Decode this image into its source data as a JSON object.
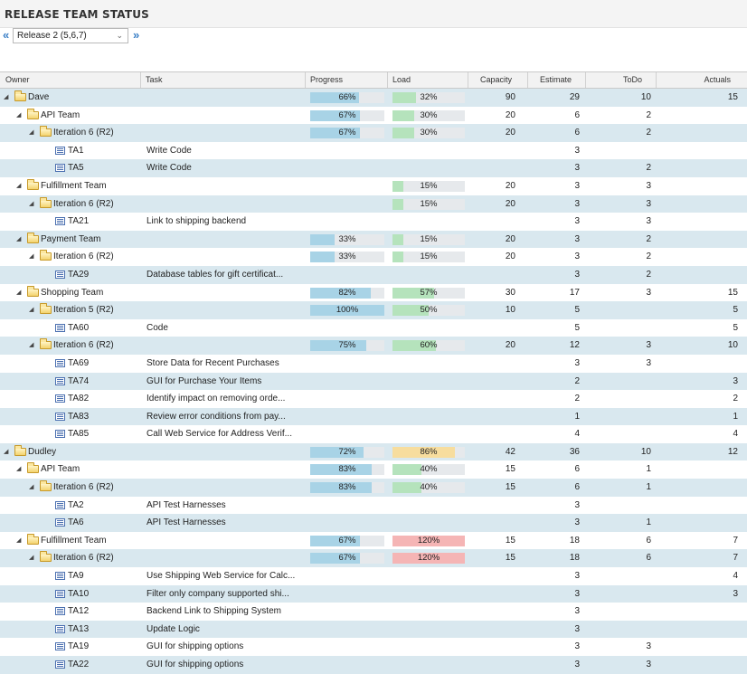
{
  "title": "RELEASE TEAM STATUS",
  "release_selector": {
    "prev": "«",
    "value": "Release 2 (5,6,7)",
    "next": "»"
  },
  "columns": {
    "owner": "Owner",
    "task": "Task",
    "progress": "Progress",
    "load": "Load",
    "capacity": "Capacity",
    "estimate": "Estimate",
    "todo": "ToDo",
    "actuals": "Actuals"
  },
  "colors": {
    "progress": "#a8d3e6",
    "load_normal": "#b5e3bc",
    "load_warning": "#f7dd9e",
    "load_over": "#f5b5b5"
  },
  "rows": [
    {
      "type": "owner",
      "level": 0,
      "owner": "Dave",
      "task": "",
      "progress": "66%",
      "progress_value": 66,
      "load": "32%",
      "load_value": 32,
      "load_state": "normal",
      "capacity": "90",
      "estimate": "29",
      "todo": "10",
      "actuals": "15"
    },
    {
      "type": "folder",
      "level": 1,
      "owner": "API Team",
      "task": "",
      "progress": "67%",
      "progress_value": 67,
      "load": "30%",
      "load_value": 30,
      "load_state": "normal",
      "capacity": "20",
      "estimate": "6",
      "todo": "2",
      "actuals": ""
    },
    {
      "type": "folder",
      "level": 2,
      "owner": "Iteration 6 (R2)",
      "task": "",
      "progress": "67%",
      "progress_value": 67,
      "load": "30%",
      "load_value": 30,
      "load_state": "normal",
      "capacity": "20",
      "estimate": "6",
      "todo": "2",
      "actuals": ""
    },
    {
      "type": "task",
      "level": 3,
      "owner": "TA1",
      "task": "Write Code",
      "progress": "",
      "load": "",
      "capacity": "",
      "estimate": "3",
      "todo": "",
      "actuals": ""
    },
    {
      "type": "task",
      "level": 3,
      "owner": "TA5",
      "task": "Write Code",
      "progress": "",
      "load": "",
      "capacity": "",
      "estimate": "3",
      "todo": "2",
      "actuals": ""
    },
    {
      "type": "folder",
      "level": 1,
      "owner": "Fulfillment Team",
      "task": "",
      "progress": "",
      "load": "15%",
      "load_value": 15,
      "load_state": "normal",
      "capacity": "20",
      "estimate": "3",
      "todo": "3",
      "actuals": ""
    },
    {
      "type": "folder",
      "level": 2,
      "owner": "Iteration 6 (R2)",
      "task": "",
      "progress": "",
      "load": "15%",
      "load_value": 15,
      "load_state": "normal",
      "capacity": "20",
      "estimate": "3",
      "todo": "3",
      "actuals": ""
    },
    {
      "type": "task",
      "level": 3,
      "owner": "TA21",
      "task": "Link to shipping backend",
      "progress": "",
      "load": "",
      "capacity": "",
      "estimate": "3",
      "todo": "3",
      "actuals": ""
    },
    {
      "type": "folder",
      "level": 1,
      "owner": "Payment Team",
      "task": "",
      "progress": "33%",
      "progress_value": 33,
      "load": "15%",
      "load_value": 15,
      "load_state": "normal",
      "capacity": "20",
      "estimate": "3",
      "todo": "2",
      "actuals": ""
    },
    {
      "type": "folder",
      "level": 2,
      "owner": "Iteration 6 (R2)",
      "task": "",
      "progress": "33%",
      "progress_value": 33,
      "load": "15%",
      "load_value": 15,
      "load_state": "normal",
      "capacity": "20",
      "estimate": "3",
      "todo": "2",
      "actuals": ""
    },
    {
      "type": "task",
      "level": 3,
      "owner": "TA29",
      "task": "Database tables for gift certificat...",
      "progress": "",
      "load": "",
      "capacity": "",
      "estimate": "3",
      "todo": "2",
      "actuals": ""
    },
    {
      "type": "folder",
      "level": 1,
      "owner": "Shopping Team",
      "task": "",
      "progress": "82%",
      "progress_value": 82,
      "load": "57%",
      "load_value": 57,
      "load_state": "normal",
      "capacity": "30",
      "estimate": "17",
      "todo": "3",
      "actuals": "15"
    },
    {
      "type": "folder",
      "level": 2,
      "owner": "Iteration 5 (R2)",
      "task": "",
      "progress": "100%",
      "progress_value": 100,
      "load": "50%",
      "load_value": 50,
      "load_state": "normal",
      "capacity": "10",
      "estimate": "5",
      "todo": "",
      "actuals": "5"
    },
    {
      "type": "task",
      "level": 3,
      "owner": "TA60",
      "task": "Code",
      "progress": "",
      "load": "",
      "capacity": "",
      "estimate": "5",
      "todo": "",
      "actuals": "5"
    },
    {
      "type": "folder",
      "level": 2,
      "owner": "Iteration 6 (R2)",
      "task": "",
      "progress": "75%",
      "progress_value": 75,
      "load": "60%",
      "load_value": 60,
      "load_state": "normal",
      "capacity": "20",
      "estimate": "12",
      "todo": "3",
      "actuals": "10"
    },
    {
      "type": "task",
      "level": 3,
      "owner": "TA69",
      "task": "Store Data for Recent Purchases",
      "progress": "",
      "load": "",
      "capacity": "",
      "estimate": "3",
      "todo": "3",
      "actuals": ""
    },
    {
      "type": "task",
      "level": 3,
      "owner": "TA74",
      "task": "GUI for Purchase Your Items",
      "progress": "",
      "load": "",
      "capacity": "",
      "estimate": "2",
      "todo": "",
      "actuals": "3"
    },
    {
      "type": "task",
      "level": 3,
      "owner": "TA82",
      "task": "Identify impact on removing orde...",
      "progress": "",
      "load": "",
      "capacity": "",
      "estimate": "2",
      "todo": "",
      "actuals": "2"
    },
    {
      "type": "task",
      "level": 3,
      "owner": "TA83",
      "task": "Review error conditions from pay...",
      "progress": "",
      "load": "",
      "capacity": "",
      "estimate": "1",
      "todo": "",
      "actuals": "1"
    },
    {
      "type": "task",
      "level": 3,
      "owner": "TA85",
      "task": "Call Web Service for Address Verif...",
      "progress": "",
      "load": "",
      "capacity": "",
      "estimate": "4",
      "todo": "",
      "actuals": "4"
    },
    {
      "type": "owner",
      "level": 0,
      "owner": "Dudley",
      "task": "",
      "progress": "72%",
      "progress_value": 72,
      "load": "86%",
      "load_value": 86,
      "load_state": "warning",
      "capacity": "42",
      "estimate": "36",
      "todo": "10",
      "actuals": "12"
    },
    {
      "type": "folder",
      "level": 1,
      "owner": "API Team",
      "task": "",
      "progress": "83%",
      "progress_value": 83,
      "load": "40%",
      "load_value": 40,
      "load_state": "normal",
      "capacity": "15",
      "estimate": "6",
      "todo": "1",
      "actuals": ""
    },
    {
      "type": "folder",
      "level": 2,
      "owner": "Iteration 6 (R2)",
      "task": "",
      "progress": "83%",
      "progress_value": 83,
      "load": "40%",
      "load_value": 40,
      "load_state": "normal",
      "capacity": "15",
      "estimate": "6",
      "todo": "1",
      "actuals": ""
    },
    {
      "type": "task",
      "level": 3,
      "owner": "TA2",
      "task": "API Test Harnesses",
      "progress": "",
      "load": "",
      "capacity": "",
      "estimate": "3",
      "todo": "",
      "actuals": ""
    },
    {
      "type": "task",
      "level": 3,
      "owner": "TA6",
      "task": "API Test Harnesses",
      "progress": "",
      "load": "",
      "capacity": "",
      "estimate": "3",
      "todo": "1",
      "actuals": ""
    },
    {
      "type": "folder",
      "level": 1,
      "owner": "Fulfillment Team",
      "task": "",
      "progress": "67%",
      "progress_value": 67,
      "load": "120%",
      "load_value": 120,
      "load_state": "over",
      "capacity": "15",
      "estimate": "18",
      "todo": "6",
      "actuals": "7"
    },
    {
      "type": "folder",
      "level": 2,
      "owner": "Iteration 6 (R2)",
      "task": "",
      "progress": "67%",
      "progress_value": 67,
      "load": "120%",
      "load_value": 120,
      "load_state": "over",
      "capacity": "15",
      "estimate": "18",
      "todo": "6",
      "actuals": "7"
    },
    {
      "type": "task",
      "level": 3,
      "owner": "TA9",
      "task": "Use Shipping Web Service for Calc...",
      "progress": "",
      "load": "",
      "capacity": "",
      "estimate": "3",
      "todo": "",
      "actuals": "4"
    },
    {
      "type": "task",
      "level": 3,
      "owner": "TA10",
      "task": "Filter only company supported shi...",
      "progress": "",
      "load": "",
      "capacity": "",
      "estimate": "3",
      "todo": "",
      "actuals": "3"
    },
    {
      "type": "task",
      "level": 3,
      "owner": "TA12",
      "task": "Backend Link to Shipping System",
      "progress": "",
      "load": "",
      "capacity": "",
      "estimate": "3",
      "todo": "",
      "actuals": ""
    },
    {
      "type": "task",
      "level": 3,
      "owner": "TA13",
      "task": "Update Logic",
      "progress": "",
      "load": "",
      "capacity": "",
      "estimate": "3",
      "todo": "",
      "actuals": ""
    },
    {
      "type": "task",
      "level": 3,
      "owner": "TA19",
      "task": "GUI for shipping options",
      "progress": "",
      "load": "",
      "capacity": "",
      "estimate": "3",
      "todo": "3",
      "actuals": ""
    },
    {
      "type": "task",
      "level": 3,
      "owner": "TA22",
      "task": "GUI for shipping options",
      "progress": "",
      "load": "",
      "capacity": "",
      "estimate": "3",
      "todo": "3",
      "actuals": ""
    }
  ]
}
